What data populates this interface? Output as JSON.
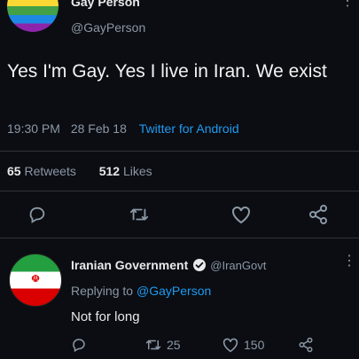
{
  "tweet": {
    "author_name": "Gay Person",
    "author_handle": "@GayPerson",
    "text": "Yes I'm Gay. Yes I live in Iran. We exist",
    "time": "19:30 PM",
    "date": "28 Feb 18",
    "source": "Twitter for Android",
    "retweets_count": "65",
    "retweets_label": "Retweets",
    "likes_count": "512",
    "likes_label": "Likes",
    "icons": [
      "reply-icon",
      "retweet-icon",
      "like-icon",
      "share-icon"
    ]
  },
  "reply": {
    "author_name": "Iranian Government",
    "author_handle": "@IranGovt",
    "replying_to_label": "Replying to",
    "replying_to_handle": "@GayPerson",
    "text": "Not for long",
    "retweets_count": "25",
    "likes_count": "150"
  },
  "colors": {
    "background": "#0b0d12",
    "link": "#1d9bf0",
    "muted": "#8b98a5"
  }
}
